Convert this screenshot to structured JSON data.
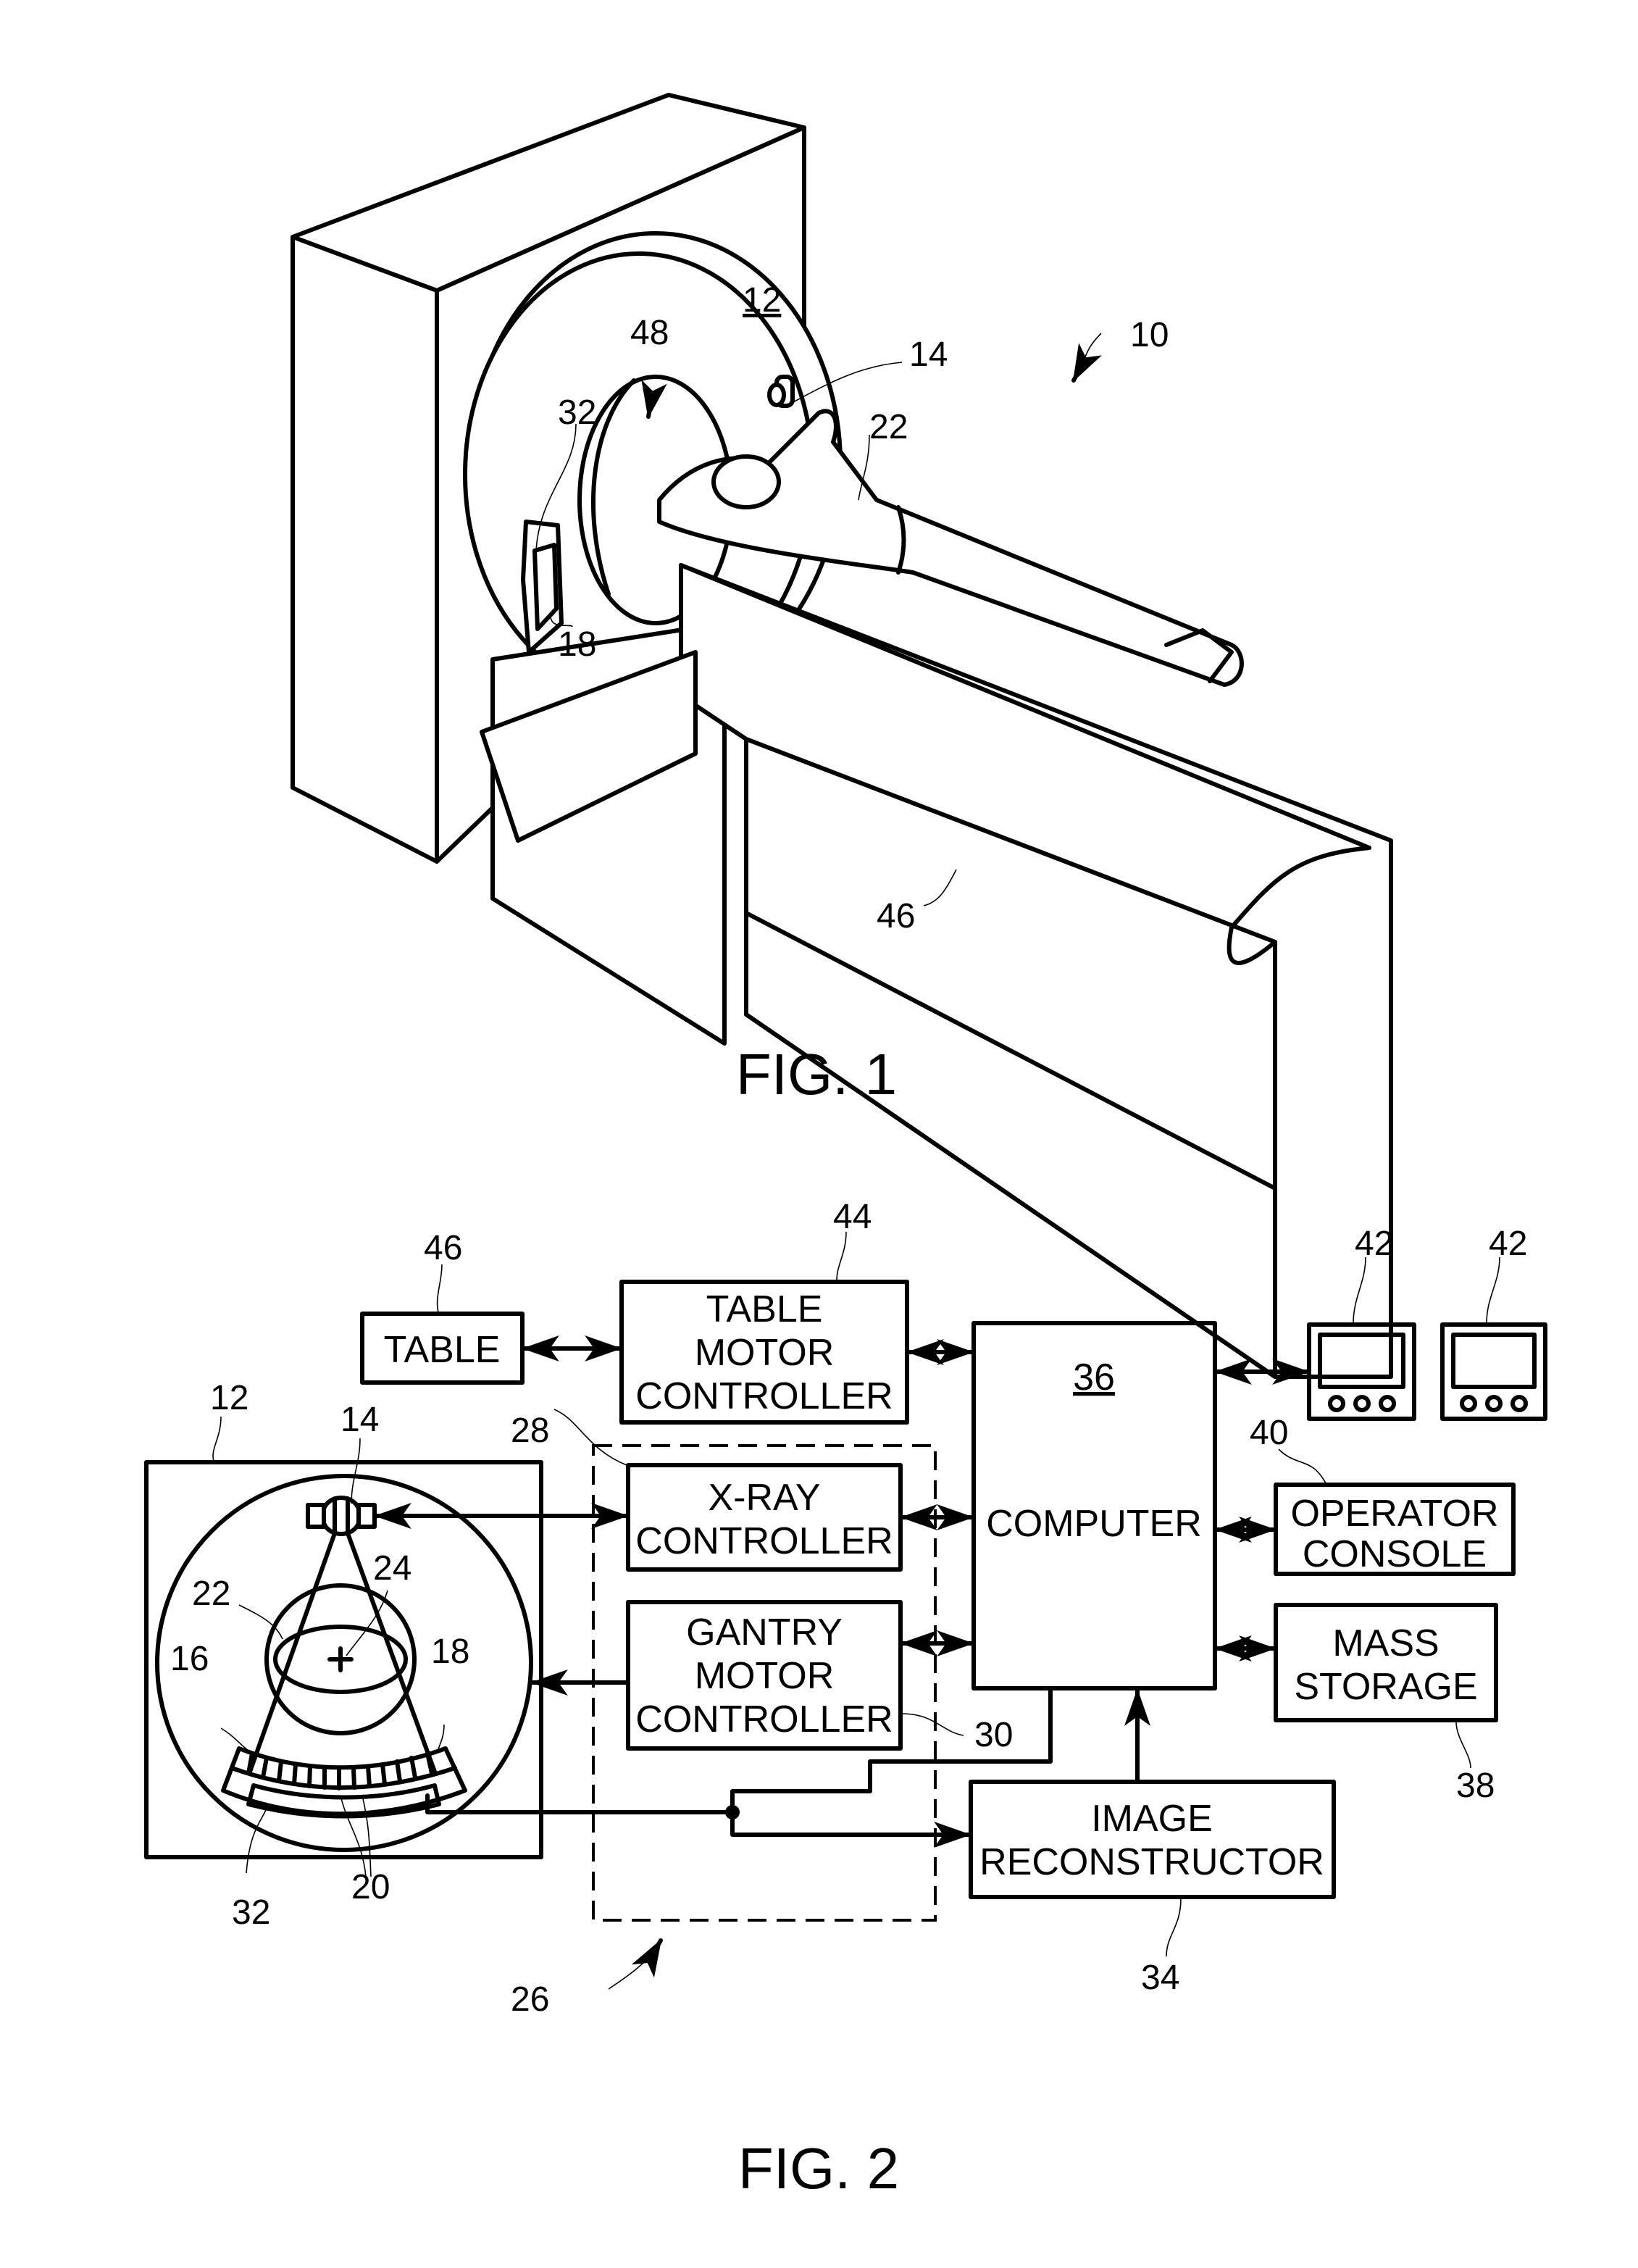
{
  "figures": [
    {
      "id": "fig1",
      "caption": "FIG. 1",
      "description": "Perspective view of CT imaging system",
      "reference_labels": {
        "system": "10",
        "gantry": "12",
        "xray_source": "14",
        "detector_array": "18",
        "patient": "22",
        "das": "32",
        "table": "46",
        "gantry_opening": "48"
      }
    },
    {
      "id": "fig2",
      "caption": "FIG. 2",
      "description": "Block diagram of CT imaging system",
      "reference_labels": {
        "gantry": "12",
        "xray_source": "14",
        "xray_beam": "16",
        "detector_array": "18",
        "detectors": "20",
        "patient": "22",
        "center_of_rotation": "24",
        "control_mechanism": "26",
        "xray_controller": "28",
        "gantry_motor_controller": "30",
        "das": "32",
        "image_reconstructor": "34",
        "computer": "36",
        "mass_storage": "38",
        "operator_console": "40",
        "display_1": "42",
        "display_2": "42",
        "table_motor_controller": "44",
        "table": "46"
      },
      "blocks": {
        "table": [
          "TABLE"
        ],
        "table_motor_controller": [
          "TABLE",
          "MOTOR",
          "CONTROLLER"
        ],
        "xray_controller": [
          "X-RAY",
          "CONTROLLER"
        ],
        "gantry_motor_controller": [
          "GANTRY",
          "MOTOR",
          "CONTROLLER"
        ],
        "computer": [
          "COMPUTER"
        ],
        "operator_console": [
          "OPERATOR",
          "CONSOLE"
        ],
        "mass_storage": [
          "MASS",
          "STORAGE"
        ],
        "image_reconstructor": [
          "IMAGE",
          "RECONSTRUCTOR"
        ]
      },
      "computer_ref": "36"
    }
  ]
}
